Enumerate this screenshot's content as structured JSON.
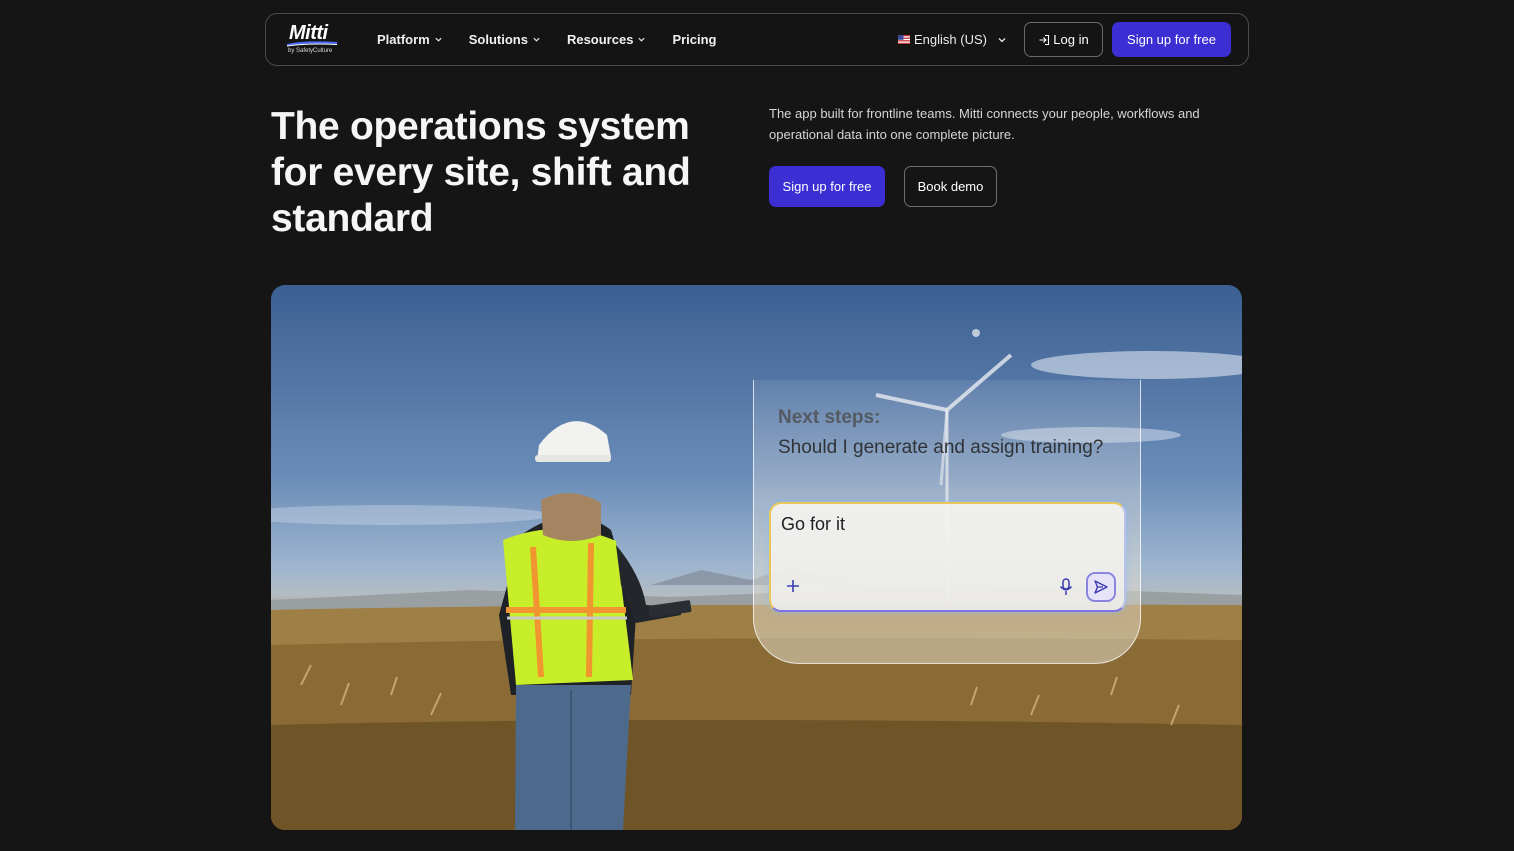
{
  "nav": {
    "logo_text": "Mitti",
    "logo_subtext": "by SafetyCulture",
    "menu": [
      {
        "label": "Platform",
        "has_dropdown": true
      },
      {
        "label": "Solutions",
        "has_dropdown": true
      },
      {
        "label": "Resources",
        "has_dropdown": true
      },
      {
        "label": "Pricing",
        "has_dropdown": false
      }
    ],
    "language": "English (US)",
    "login_label": "Log in",
    "signup_label": "Sign up for free"
  },
  "hero": {
    "title": "The operations system for every site, shift and standard",
    "description": "The app built for frontline teams. Mitti connects your people, workflows and operational data into one complete picture.",
    "signup_label": "Sign up for free",
    "demo_label": "Book demo"
  },
  "chat": {
    "heading": "Next steps:",
    "question": "Should I generate and assign training?",
    "input_value": "Go for it"
  },
  "icons": {
    "language": "us-flag-icon",
    "dropdown": "chevron-down-icon",
    "login": "login-arrow-icon",
    "add": "plus-icon",
    "mic": "microphone-icon",
    "send": "send-icon"
  },
  "colors": {
    "background": "#151515",
    "primary": "#3b2fd4",
    "nav_border": "#4a4a4a",
    "text": "#f2f2f2"
  }
}
